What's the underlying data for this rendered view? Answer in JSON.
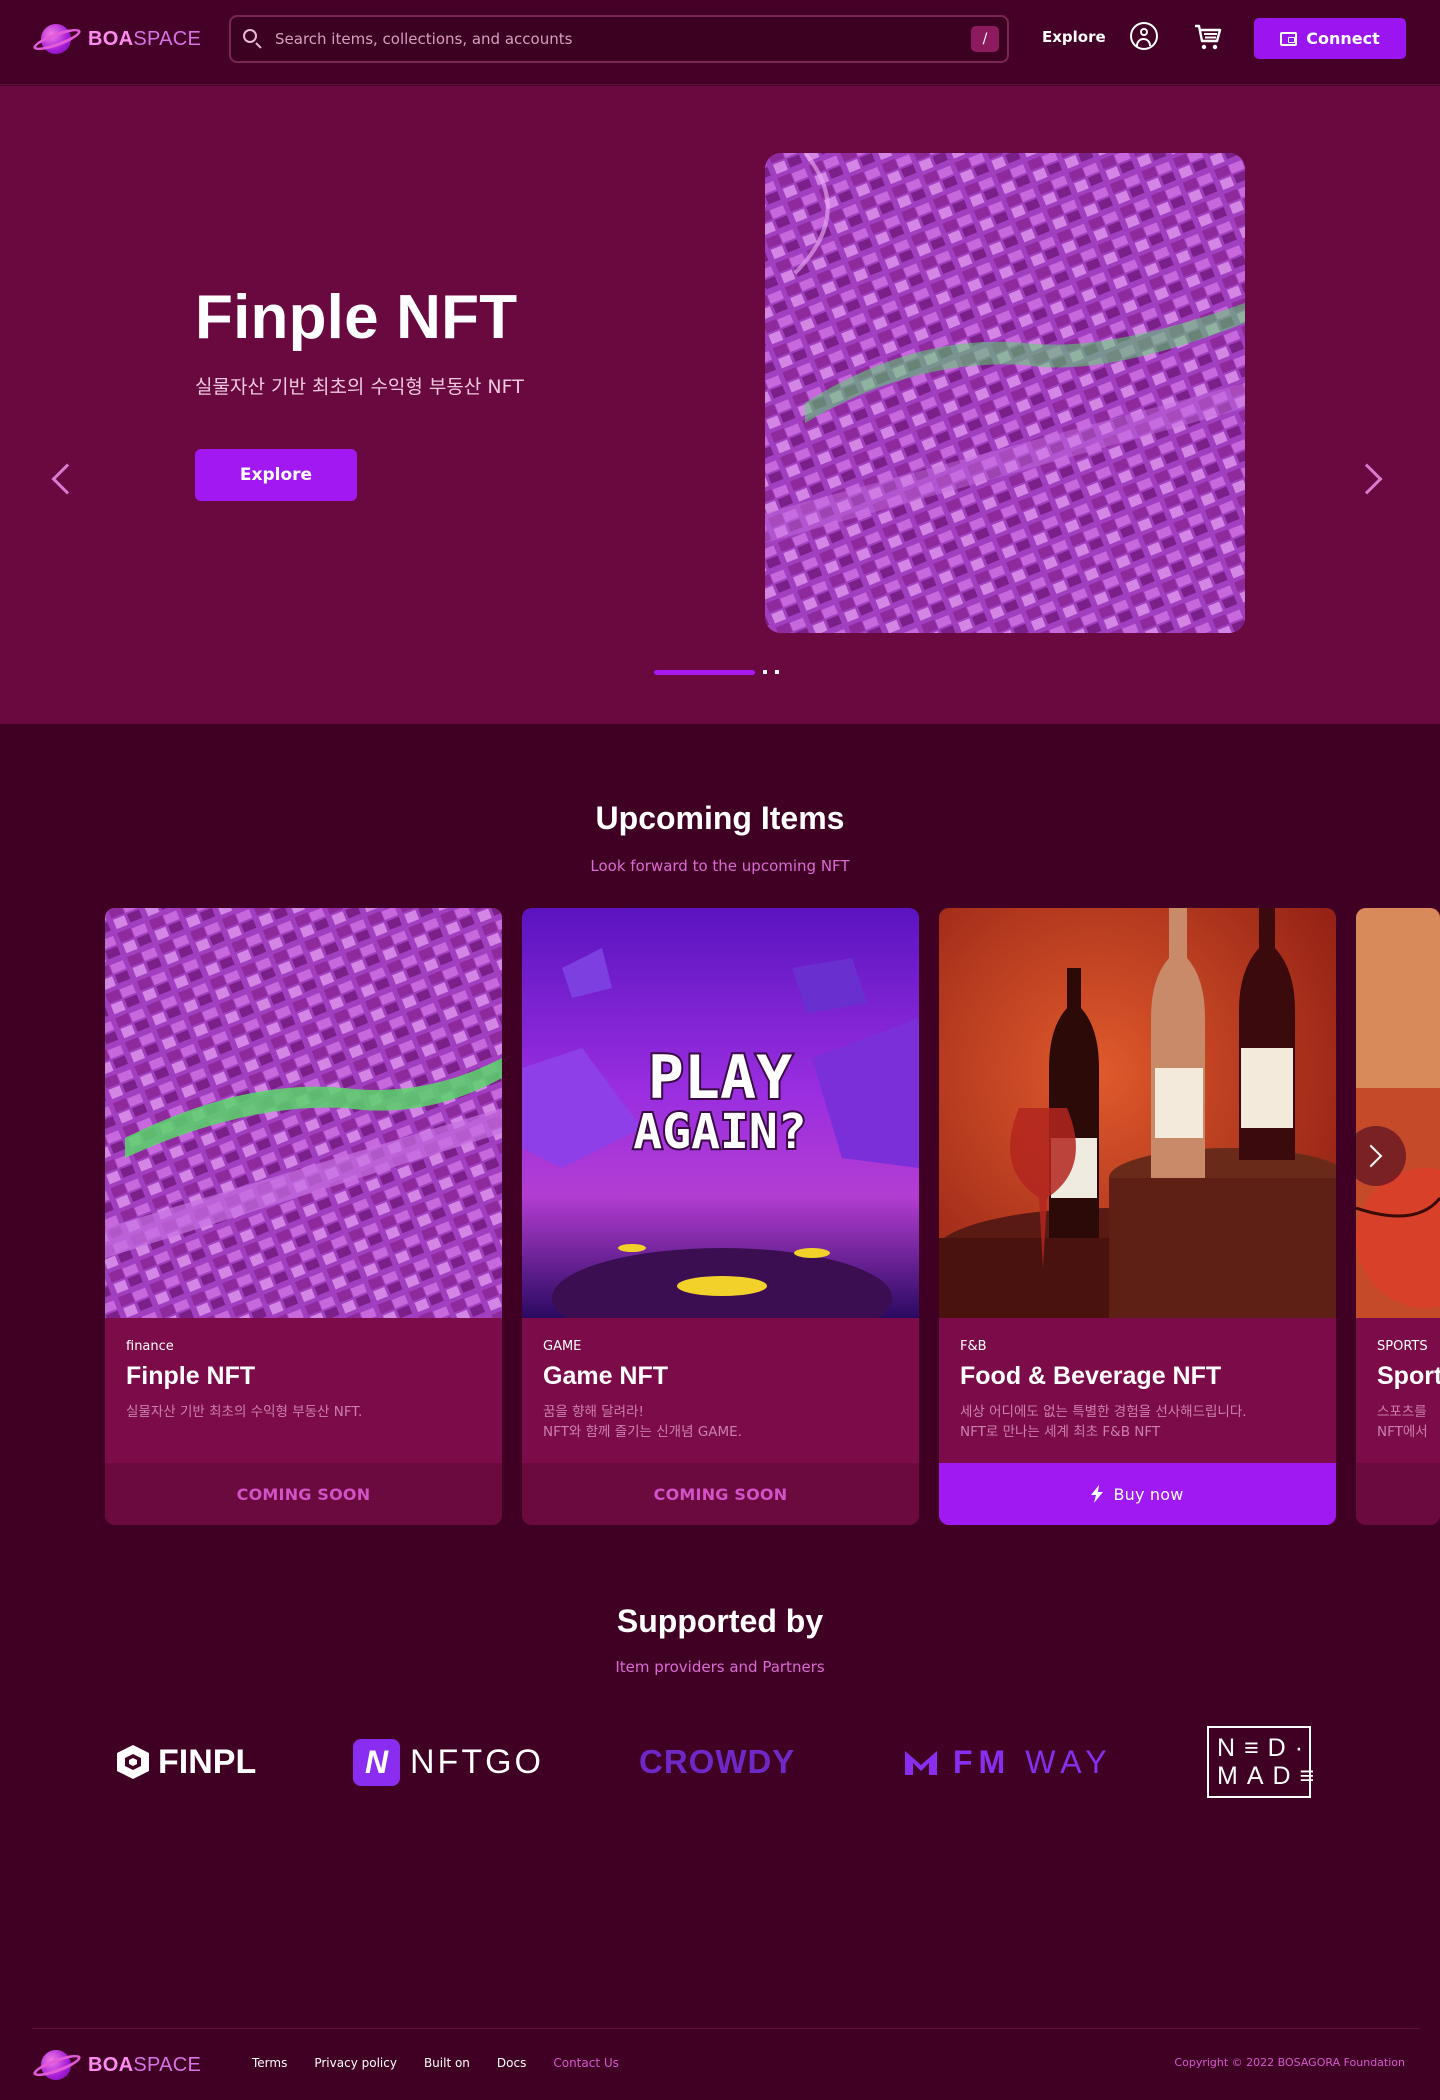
{
  "header": {
    "logo_bold": "BOA",
    "logo_light": "SPACE",
    "search_placeholder": "Search items, collections, and accounts",
    "search_shortcut": "/",
    "explore": "Explore",
    "connect": "Connect"
  },
  "hero": {
    "title": "Finple NFT",
    "subtitle": "실물자산 기반 최초의 수익형 부동산 NFT",
    "button": "Explore"
  },
  "upcoming": {
    "title": "Upcoming Items",
    "subtitle": "Look forward to the upcoming NFT",
    "cards": [
      {
        "category": "finance",
        "name": "Finple NFT",
        "desc1": "실물자산 기반 최초의 수익형 부동산 NFT.",
        "desc2": "",
        "action": "COMING SOON"
      },
      {
        "category": "GAME",
        "name": "Game NFT",
        "desc1": "꿈을 향해 달려라!",
        "desc2": "NFT와 함께 즐기는 신개념 GAME.",
        "action": "COMING SOON",
        "art_text1": "PLAY",
        "art_text2": "AGAIN?"
      },
      {
        "category": "F&B",
        "name": "Food & Beverage NFT",
        "desc1": "세상 어디에도 없는 특별한 경험을 선사해드립니다.",
        "desc2": "NFT로 만나는 세계 최초 F&B NFT",
        "action": "Buy now"
      },
      {
        "category": "SPORTS",
        "name": "Sport",
        "desc1": "스포츠를 ",
        "desc2": "NFT에서"
      }
    ]
  },
  "supported": {
    "title": "Supported by",
    "subtitle": "Item providers and Partners",
    "partners": {
      "finpl": "FINPL",
      "nftgo": "NFTGO",
      "nftgo_mark": "N",
      "crowdy": "CROWDY",
      "fm": "FM",
      "way": "WAY",
      "need1": "N≡D·",
      "need2": "MAD≡"
    }
  },
  "footer": {
    "links": [
      "Terms",
      "Privacy policy",
      "Built on",
      "Docs",
      "Contact Us"
    ],
    "copyright": "Copyright © 2022 BOSAGORA Foundation"
  },
  "colors": {
    "accent": "#a218f2",
    "bg": "#400024",
    "hero_bg": "#6a0840",
    "card_bg": "#7c0c49"
  }
}
